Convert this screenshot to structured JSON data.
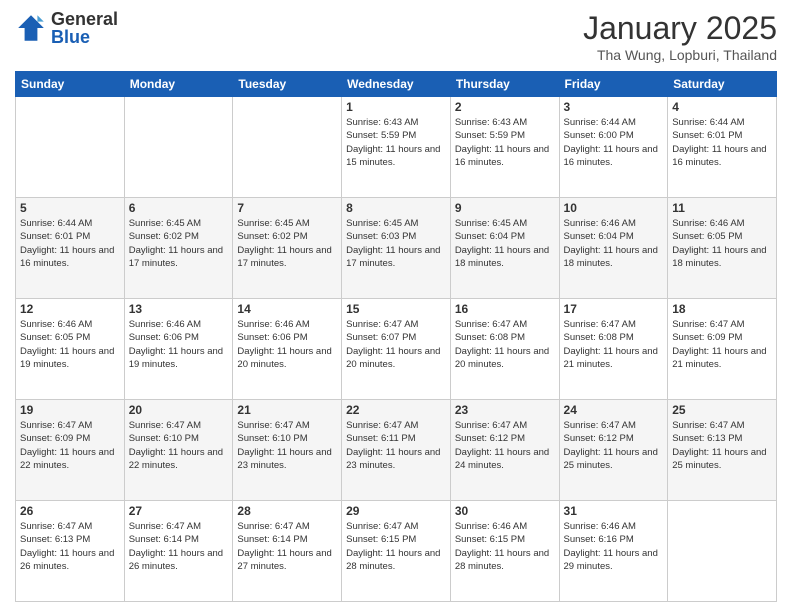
{
  "header": {
    "logo": {
      "general": "General",
      "blue": "Blue"
    },
    "title": "January 2025",
    "location": "Tha Wung, Lopburi, Thailand"
  },
  "days_of_week": [
    "Sunday",
    "Monday",
    "Tuesday",
    "Wednesday",
    "Thursday",
    "Friday",
    "Saturday"
  ],
  "weeks": [
    [
      {
        "day": "",
        "info": ""
      },
      {
        "day": "",
        "info": ""
      },
      {
        "day": "",
        "info": ""
      },
      {
        "day": "1",
        "info": "Sunrise: 6:43 AM\nSunset: 5:59 PM\nDaylight: 11 hours and 15 minutes."
      },
      {
        "day": "2",
        "info": "Sunrise: 6:43 AM\nSunset: 5:59 PM\nDaylight: 11 hours and 16 minutes."
      },
      {
        "day": "3",
        "info": "Sunrise: 6:44 AM\nSunset: 6:00 PM\nDaylight: 11 hours and 16 minutes."
      },
      {
        "day": "4",
        "info": "Sunrise: 6:44 AM\nSunset: 6:01 PM\nDaylight: 11 hours and 16 minutes."
      }
    ],
    [
      {
        "day": "5",
        "info": "Sunrise: 6:44 AM\nSunset: 6:01 PM\nDaylight: 11 hours and 16 minutes."
      },
      {
        "day": "6",
        "info": "Sunrise: 6:45 AM\nSunset: 6:02 PM\nDaylight: 11 hours and 17 minutes."
      },
      {
        "day": "7",
        "info": "Sunrise: 6:45 AM\nSunset: 6:02 PM\nDaylight: 11 hours and 17 minutes."
      },
      {
        "day": "8",
        "info": "Sunrise: 6:45 AM\nSunset: 6:03 PM\nDaylight: 11 hours and 17 minutes."
      },
      {
        "day": "9",
        "info": "Sunrise: 6:45 AM\nSunset: 6:04 PM\nDaylight: 11 hours and 18 minutes."
      },
      {
        "day": "10",
        "info": "Sunrise: 6:46 AM\nSunset: 6:04 PM\nDaylight: 11 hours and 18 minutes."
      },
      {
        "day": "11",
        "info": "Sunrise: 6:46 AM\nSunset: 6:05 PM\nDaylight: 11 hours and 18 minutes."
      }
    ],
    [
      {
        "day": "12",
        "info": "Sunrise: 6:46 AM\nSunset: 6:05 PM\nDaylight: 11 hours and 19 minutes."
      },
      {
        "day": "13",
        "info": "Sunrise: 6:46 AM\nSunset: 6:06 PM\nDaylight: 11 hours and 19 minutes."
      },
      {
        "day": "14",
        "info": "Sunrise: 6:46 AM\nSunset: 6:06 PM\nDaylight: 11 hours and 20 minutes."
      },
      {
        "day": "15",
        "info": "Sunrise: 6:47 AM\nSunset: 6:07 PM\nDaylight: 11 hours and 20 minutes."
      },
      {
        "day": "16",
        "info": "Sunrise: 6:47 AM\nSunset: 6:08 PM\nDaylight: 11 hours and 20 minutes."
      },
      {
        "day": "17",
        "info": "Sunrise: 6:47 AM\nSunset: 6:08 PM\nDaylight: 11 hours and 21 minutes."
      },
      {
        "day": "18",
        "info": "Sunrise: 6:47 AM\nSunset: 6:09 PM\nDaylight: 11 hours and 21 minutes."
      }
    ],
    [
      {
        "day": "19",
        "info": "Sunrise: 6:47 AM\nSunset: 6:09 PM\nDaylight: 11 hours and 22 minutes."
      },
      {
        "day": "20",
        "info": "Sunrise: 6:47 AM\nSunset: 6:10 PM\nDaylight: 11 hours and 22 minutes."
      },
      {
        "day": "21",
        "info": "Sunrise: 6:47 AM\nSunset: 6:10 PM\nDaylight: 11 hours and 23 minutes."
      },
      {
        "day": "22",
        "info": "Sunrise: 6:47 AM\nSunset: 6:11 PM\nDaylight: 11 hours and 23 minutes."
      },
      {
        "day": "23",
        "info": "Sunrise: 6:47 AM\nSunset: 6:12 PM\nDaylight: 11 hours and 24 minutes."
      },
      {
        "day": "24",
        "info": "Sunrise: 6:47 AM\nSunset: 6:12 PM\nDaylight: 11 hours and 25 minutes."
      },
      {
        "day": "25",
        "info": "Sunrise: 6:47 AM\nSunset: 6:13 PM\nDaylight: 11 hours and 25 minutes."
      }
    ],
    [
      {
        "day": "26",
        "info": "Sunrise: 6:47 AM\nSunset: 6:13 PM\nDaylight: 11 hours and 26 minutes."
      },
      {
        "day": "27",
        "info": "Sunrise: 6:47 AM\nSunset: 6:14 PM\nDaylight: 11 hours and 26 minutes."
      },
      {
        "day": "28",
        "info": "Sunrise: 6:47 AM\nSunset: 6:14 PM\nDaylight: 11 hours and 27 minutes."
      },
      {
        "day": "29",
        "info": "Sunrise: 6:47 AM\nSunset: 6:15 PM\nDaylight: 11 hours and 28 minutes."
      },
      {
        "day": "30",
        "info": "Sunrise: 6:46 AM\nSunset: 6:15 PM\nDaylight: 11 hours and 28 minutes."
      },
      {
        "day": "31",
        "info": "Sunrise: 6:46 AM\nSunset: 6:16 PM\nDaylight: 11 hours and 29 minutes."
      },
      {
        "day": "",
        "info": ""
      }
    ]
  ]
}
